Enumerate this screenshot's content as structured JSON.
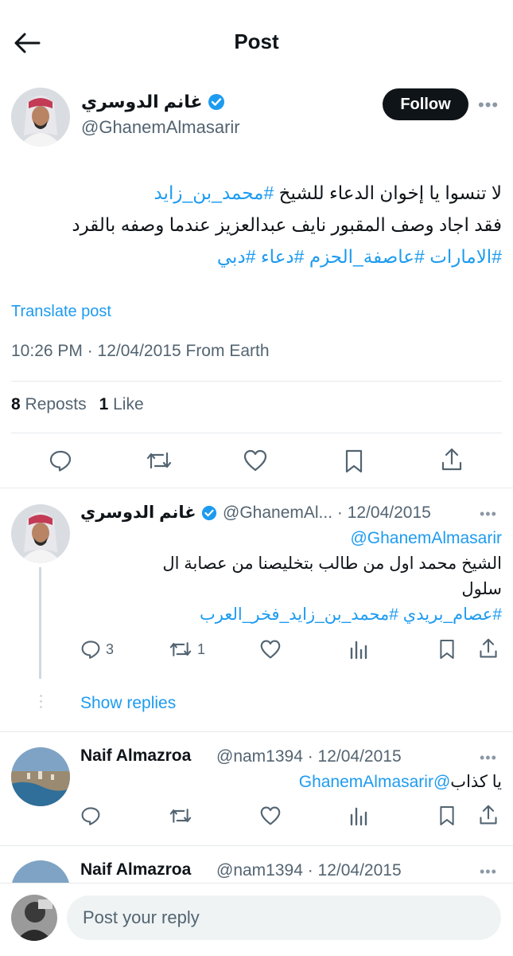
{
  "header": {
    "title": "Post"
  },
  "main_post": {
    "author_name": "غانم الدوسري",
    "handle": "@GhanemAlmasarir",
    "follow_label": "Follow",
    "text_line1_plain": "لا تنسوا يا إخوان الدعاء للشيخ ",
    "text_line1_tag": "#محمد_بن_زايد",
    "text_line2": "فقد اجاد وصف المقبور نايف عبدالعزيز عندما وصفه بالقرد",
    "hashtags_line3": "#الامارات #عاصفة_الحزم #دعاء #دبي",
    "translate_label": "Translate post",
    "meta": "10:26 PM · 12/04/2015 From Earth",
    "reposts_count": "8",
    "reposts_label": "Reposts",
    "likes_count": "1",
    "likes_label": "Like"
  },
  "reply1": {
    "author_name": "غانم الدوسري",
    "meta": "@GhanemAl... · 12/04/2015",
    "mention": "@GhanemAlmasarir",
    "text": "الشيخ محمد اول من طالب بتخليصنا من عصابة ال سلول",
    "hashtags": "#عصام_بريدي #محمد_بن_زايد_فخر_العرب",
    "reply_count": "3",
    "repost_count": "1",
    "show_replies": "Show replies"
  },
  "reply2": {
    "author_name": "Naif Almazroa",
    "meta": "@nam1394 · 12/04/2015",
    "mention": "@GhanemAlmasarir",
    "text": " يا كذاب"
  },
  "reply3": {
    "author_name": "Naif Almazroa",
    "meta": "@nam1394 · 12/04/2015"
  },
  "composer": {
    "placeholder": "Post your reply"
  },
  "colors": {
    "accent": "#1d9bf0",
    "verified": "#1d9bf0",
    "text": "#0f1419",
    "secondary": "#536471"
  }
}
